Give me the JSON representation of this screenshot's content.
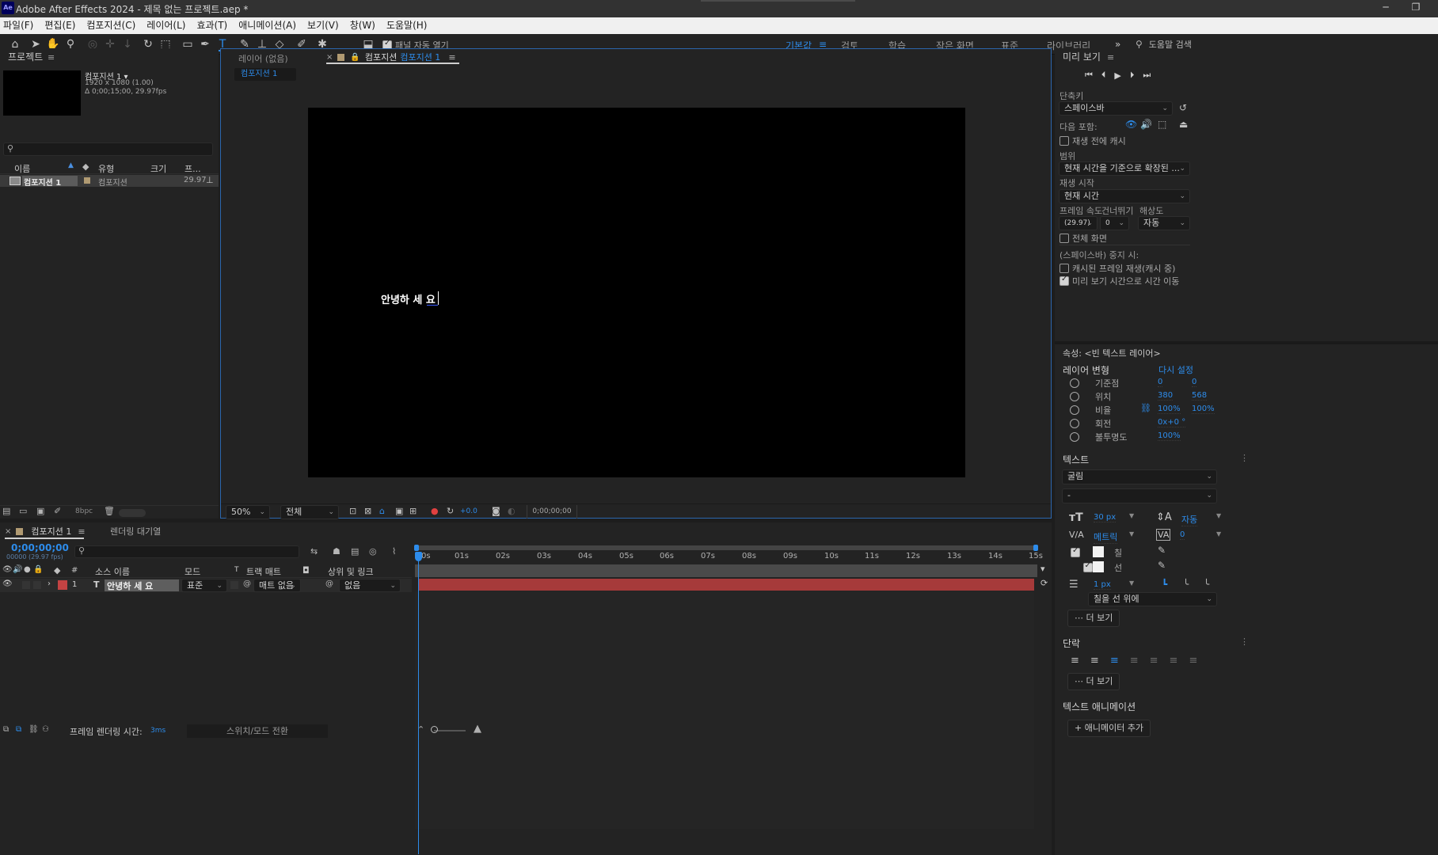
{
  "window": {
    "title": "Adobe After Effects 2024 - 제목 없는 프로젝트.aep *",
    "app_badge": "Ae",
    "minimize": "─",
    "restore": "❐"
  },
  "menu": [
    "파일(F)",
    "편집(E)",
    "컴포지션(C)",
    "레이어(L)",
    "효과(T)",
    "애니메이션(A)",
    "보기(V)",
    "창(W)",
    "도움말(H)"
  ],
  "toolbar": {
    "panel_auto_open_label": "패널 자동 열기",
    "workspaces": [
      "기본값",
      "검토",
      "학습",
      "작은 화면",
      "표준",
      "라이브러리"
    ],
    "active_workspace": "기본값",
    "more": "»",
    "help_search_placeholder": "도움말 검색"
  },
  "project": {
    "title": "프로젝트",
    "comp_name": "컴포지션 1 ▾",
    "comp_size": "1920 x 1080 (1.00)",
    "comp_duration": "Δ 0;00;15;00, 29.97fps",
    "columns": [
      "이름",
      "유형",
      "크기",
      "프..."
    ],
    "item_name": "컴포지션 1",
    "item_type": "컴포지션",
    "item_fps": "29.97",
    "bpc": "8bpc"
  },
  "viewer": {
    "tab_layer": "레이어 (없음)",
    "tab_comp_prefix": "컴포지션",
    "tab_comp_name": "컴포지션 1",
    "breadcrumb": "컴포지션 1",
    "canvas_text": "안녕하 세 요",
    "zoom": "50%",
    "resolution": "전체",
    "exposure": "+0.0",
    "timecode": "0;00;00;00"
  },
  "timeline": {
    "tab_comp": "컴포지션 1",
    "tab_render": "렌더링 대기열",
    "current_time": "0;00;00;00",
    "frame_info": "00000 (29.97 fps)",
    "columns": {
      "num": "#",
      "source": "소스 이름",
      "mode": "모드",
      "t": "T",
      "track_matte": "트랙 매트",
      "parent": "상위 및 링크"
    },
    "layer": {
      "index": "1",
      "type": "T",
      "name": "안녕하 세 요",
      "mode": "표준",
      "matte": "매트 없음",
      "parent": "없음"
    },
    "ruler": [
      "0s",
      "01s",
      "02s",
      "03s",
      "04s",
      "05s",
      "06s",
      "07s",
      "08s",
      "09s",
      "10s",
      "11s",
      "12s",
      "13s",
      "14s",
      "15s"
    ],
    "footer_render_label": "프레임 렌더링 시간:",
    "footer_render_value": "3ms",
    "footer_toggle": "스위치/모드 전환"
  },
  "preview": {
    "title": "미리 보기",
    "shortcut_label": "단축키",
    "shortcut_value": "스페이스바",
    "include_label": "다음 포함:",
    "cache_before": "재생 전에 캐시",
    "range_label": "범위",
    "range_value": "현재 시간을 기준으로 확장된 ...",
    "play_from_label": "재생 시작",
    "play_from_value": "현재 시간",
    "fps_label": "프레임 속도",
    "skip_label": "건너뛰기",
    "res_label": "해상도",
    "fps_value": "(29.97)",
    "skip_value": "0",
    "res_value": "자동",
    "fullscreen": "전체 화면",
    "on_stop_label": "(스페이스바) 중지 시:",
    "opt_cached": "캐시된 프레임 재생(캐시 중)",
    "opt_move_time": "미리 보기 시간으로 시간 이동",
    "opt_cached_checked": false,
    "opt_move_time_checked": true
  },
  "properties": {
    "header": "속성: <빈 텍스트 레이어>",
    "transform_label": "레이어 변형",
    "reset": "다시 설정",
    "rows": [
      {
        "name": "기준점",
        "v1": "0",
        "v2": "0"
      },
      {
        "name": "위치",
        "v1": "380",
        "v2": "568"
      },
      {
        "name": "비율",
        "v1": "100%",
        "v2": "100%"
      },
      {
        "name": "회전",
        "v1": "0x+0 °",
        "v2": ""
      },
      {
        "name": "불투명도",
        "v1": "100%",
        "v2": ""
      }
    ],
    "text_label": "텍스트",
    "font": "굴림",
    "style": "-",
    "font_size": "30 px",
    "leading": "자동",
    "kerning": "메트릭",
    "tracking": "0",
    "fill_label": "칠",
    "stroke_label": "선",
    "stroke_width": "1 px",
    "stroke_order": "칠을 선 위에",
    "more": "더 보기",
    "paragraph_label": "단락",
    "animation_label": "텍스트 애니메이션",
    "add_animator": "애니메이터 추가"
  },
  "colors": {
    "accent": "#2d8ceb",
    "layer_bar": "#a63a3a",
    "label_red": "#c44343",
    "comp_label": "#b09a72"
  }
}
